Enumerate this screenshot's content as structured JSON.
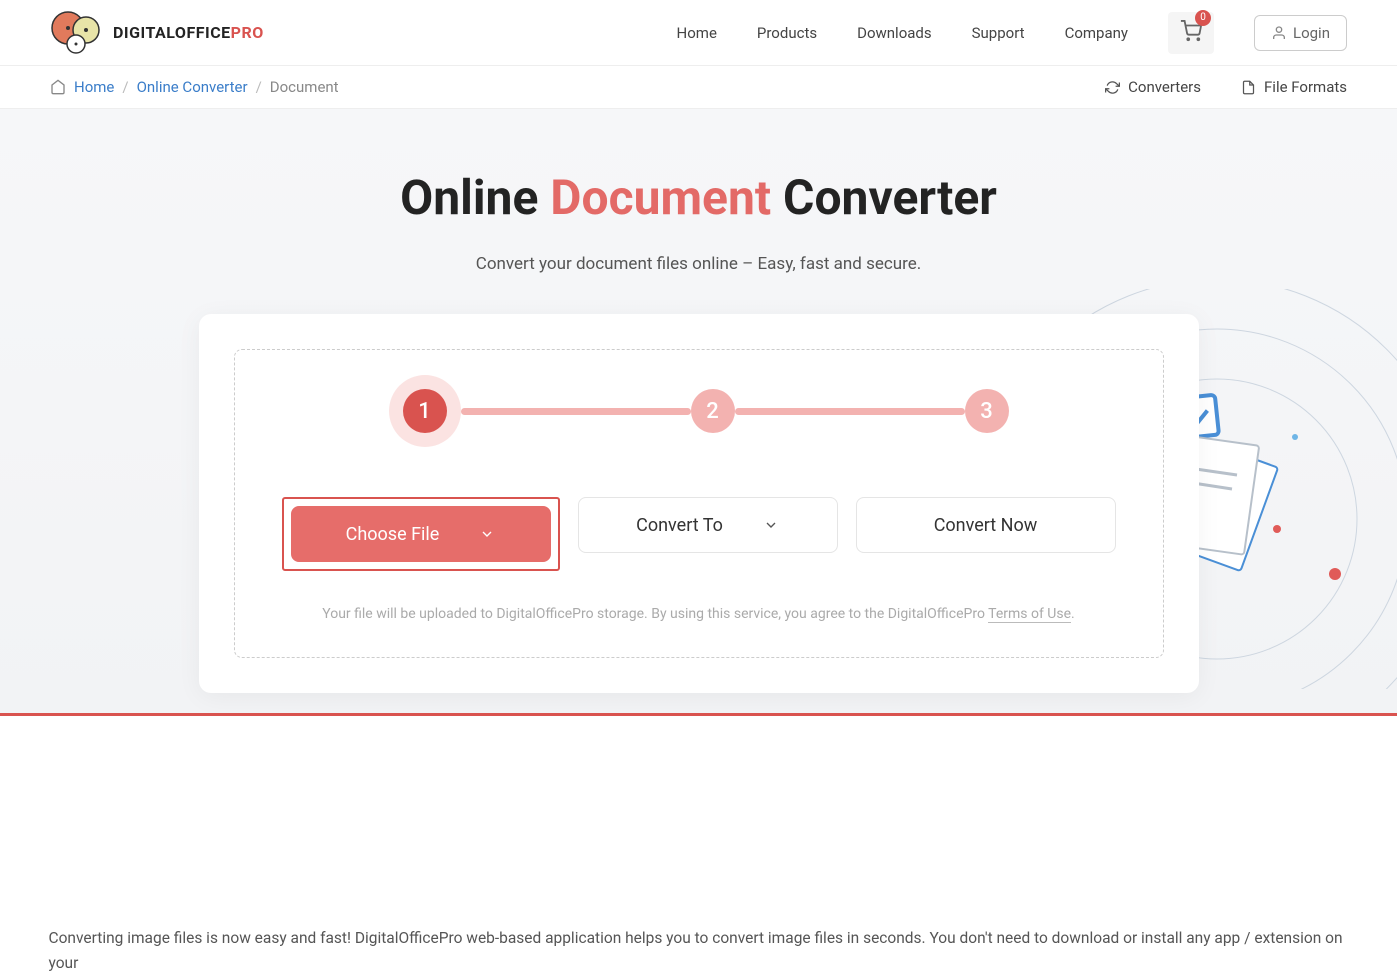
{
  "brand": {
    "name_part1": "DIGITALOFFICE",
    "name_part2": "PRO"
  },
  "nav": {
    "home": "Home",
    "products": "Products",
    "downloads": "Downloads",
    "support": "Support",
    "company": "Company"
  },
  "cart": {
    "count": "0"
  },
  "login": {
    "label": "Login"
  },
  "breadcrumb": {
    "home": "Home",
    "converter": "Online Converter",
    "current": "Document"
  },
  "subnav": {
    "converters": "Converters",
    "formats": "File Formats"
  },
  "hero": {
    "title_pre": "Online ",
    "title_accent": "Document",
    "title_post": " Converter",
    "sub": "Convert your document files online – Easy, fast and secure."
  },
  "steps": {
    "s1": "1",
    "s2": "2",
    "s3": "3"
  },
  "actions": {
    "choose": "Choose File",
    "convert_to": "Convert To",
    "convert_now": "Convert Now"
  },
  "fineprint": {
    "p1": "Your file will be uploaded to DigitalOfficePro storage.  By using this service, you agree to the DigitalOfficePro ",
    "terms": "Terms of Use",
    "dot": "."
  },
  "bottom": "Converting image files is now easy and fast! DigitalOfficePro web-based application helps you to convert image files in seconds. You don't need to download or install any app / extension on your"
}
